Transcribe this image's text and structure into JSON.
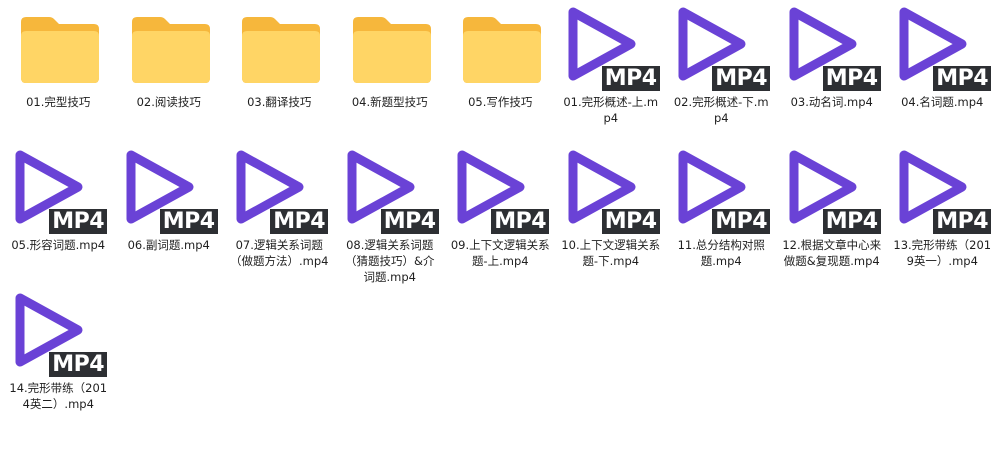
{
  "colors": {
    "folder_back": "#f6b73c",
    "folder_front": "#ffd565",
    "play_stroke": "#6a42d6",
    "badge_bg": "#2d2f33",
    "badge_text": "#ffffff"
  },
  "badge_text": "MP4",
  "items": [
    {
      "type": "folder",
      "icon": "folder-icon",
      "name": "01.完型技巧"
    },
    {
      "type": "folder",
      "icon": "folder-icon",
      "name": "02.阅读技巧"
    },
    {
      "type": "folder",
      "icon": "folder-icon",
      "name": "03.翻译技巧"
    },
    {
      "type": "folder",
      "icon": "folder-icon",
      "name": "04.新题型技巧"
    },
    {
      "type": "folder",
      "icon": "folder-icon",
      "name": "05.写作技巧"
    },
    {
      "type": "video",
      "icon": "video-file-icon",
      "name": "01.完形概述-上.mp4"
    },
    {
      "type": "video",
      "icon": "video-file-icon",
      "name": "02.完形概述-下.mp4"
    },
    {
      "type": "video",
      "icon": "video-file-icon",
      "name": "03.动名词.mp4"
    },
    {
      "type": "video",
      "icon": "video-file-icon",
      "name": "04.名词题.mp4"
    },
    {
      "type": "video",
      "icon": "video-file-icon",
      "name": "05.形容词题.mp4"
    },
    {
      "type": "video",
      "icon": "video-file-icon",
      "name": "06.副词题.mp4"
    },
    {
      "type": "video",
      "icon": "video-file-icon",
      "name": "07.逻辑关系词题（做题方法）.mp4"
    },
    {
      "type": "video",
      "icon": "video-file-icon",
      "name": "08.逻辑关系词题（猜题技巧）&介词题.mp4"
    },
    {
      "type": "video",
      "icon": "video-file-icon",
      "name": "09.上下文逻辑关系题-上.mp4"
    },
    {
      "type": "video",
      "icon": "video-file-icon",
      "name": "10.上下文逻辑关系题-下.mp4"
    },
    {
      "type": "video",
      "icon": "video-file-icon",
      "name": "11.总分结构对照题.mp4"
    },
    {
      "type": "video",
      "icon": "video-file-icon",
      "name": "12.根据文章中心来做题&复现题.mp4"
    },
    {
      "type": "video",
      "icon": "video-file-icon",
      "name": "13.完形带练（2019英一）.mp4"
    },
    {
      "type": "video",
      "icon": "video-file-icon",
      "name": "14.完形带练（2014英二）.mp4"
    }
  ]
}
